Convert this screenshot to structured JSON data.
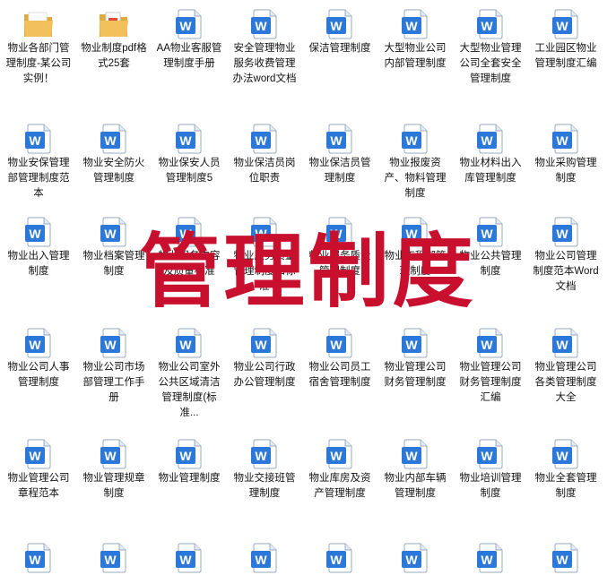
{
  "colors": {
    "word_blue": "#2b78d8",
    "watermark_red": "#c8102e",
    "folder_yellow": "#f2c05a"
  },
  "watermark": "管理制度",
  "items": [
    {
      "label": "物业各部门管理制度-某公司实例！",
      "icon": "folder-icon"
    },
    {
      "label": "物业制度pdf格式25套",
      "icon": "folder-icon"
    },
    {
      "label": "AA物业客服管理制度手册",
      "icon": "word-doc-icon"
    },
    {
      "label": "安全管理物业服务收费管理办法word文档",
      "icon": "word-doc-icon"
    },
    {
      "label": "保洁管理制度",
      "icon": "word-doc-icon"
    },
    {
      "label": "大型物业公司内部管理制度",
      "icon": "word-doc-icon"
    },
    {
      "label": "大型物业管理公司全套安全管理制度",
      "icon": "word-doc-icon"
    },
    {
      "label": "工业园区物业管理制度汇编",
      "icon": "word-doc-icon"
    },
    {
      "label": "物业安保管理部管理制度范本",
      "icon": "word-doc-icon"
    },
    {
      "label": "物业安全防火管理制度",
      "icon": "word-doc-icon"
    },
    {
      "label": "物业保安人员管理制度5",
      "icon": "word-doc-icon"
    },
    {
      "label": "物业保洁员岗位职责",
      "icon": "word-doc-icon"
    },
    {
      "label": "物业保洁员管理制度",
      "icon": "word-doc-icon"
    },
    {
      "label": "物业报废资产、物料管理制度",
      "icon": "word-doc-icon"
    },
    {
      "label": "物业材料出入库管理制度",
      "icon": "word-doc-icon"
    },
    {
      "label": "物业采购管理制度",
      "icon": "word-doc-icon"
    },
    {
      "label": "物业出入管理制度",
      "icon": "word-doc-icon"
    },
    {
      "label": "物业档案管理制度",
      "icon": "word-doc-icon"
    },
    {
      "label": "物业服务内容及质量标准",
      "icon": "word-doc-icon"
    },
    {
      "label": "物业服务质量管理制度和标准",
      "icon": "word-doc-icon"
    },
    {
      "label": "物业服务质量管理制度",
      "icon": "word-doc-icon"
    },
    {
      "label": "物业工程部管理制度",
      "icon": "word-doc-icon"
    },
    {
      "label": "物业公共管理制度",
      "icon": "word-doc-icon"
    },
    {
      "label": "物业公司管理制度范本Word文档",
      "icon": "word-doc-icon"
    },
    {
      "label": "物业公司人事管理制度",
      "icon": "word-doc-icon"
    },
    {
      "label": "物业公司市场部管理工作手册",
      "icon": "word-doc-icon"
    },
    {
      "label": "物业公司室外公共区域清洁管理制度(标准...",
      "icon": "word-doc-icon"
    },
    {
      "label": "物业公司行政办公管理制度",
      "icon": "word-doc-icon"
    },
    {
      "label": "物业公司员工宿舍管理制度",
      "icon": "word-doc-icon"
    },
    {
      "label": "物业管理公司财务管理制度",
      "icon": "word-doc-icon"
    },
    {
      "label": "物业管理公司财务管理制度汇编",
      "icon": "word-doc-icon"
    },
    {
      "label": "物业管理公司各类管理制度大全",
      "icon": "word-doc-icon"
    },
    {
      "label": "物业管理公司章程范本",
      "icon": "word-doc-icon"
    },
    {
      "label": "物业管理规章制度",
      "icon": "word-doc-icon"
    },
    {
      "label": "物业管理制度",
      "icon": "word-doc-icon"
    },
    {
      "label": "物业交接班管理制度",
      "icon": "word-doc-icon"
    },
    {
      "label": "物业库房及资产管理制度",
      "icon": "word-doc-icon"
    },
    {
      "label": "物业内部车辆管理制度",
      "icon": "word-doc-icon"
    },
    {
      "label": "物业培训管理制度",
      "icon": "word-doc-icon"
    },
    {
      "label": "物业全套管理制度",
      "icon": "word-doc-icon"
    },
    {
      "label": "",
      "icon": "word-doc-icon"
    },
    {
      "label": "",
      "icon": "word-doc-icon"
    },
    {
      "label": "",
      "icon": "word-doc-icon"
    },
    {
      "label": "",
      "icon": "word-doc-icon"
    },
    {
      "label": "",
      "icon": "word-doc-icon"
    },
    {
      "label": "",
      "icon": "word-doc-icon"
    },
    {
      "label": "",
      "icon": "word-doc-icon"
    },
    {
      "label": "",
      "icon": "word-doc-icon"
    }
  ]
}
